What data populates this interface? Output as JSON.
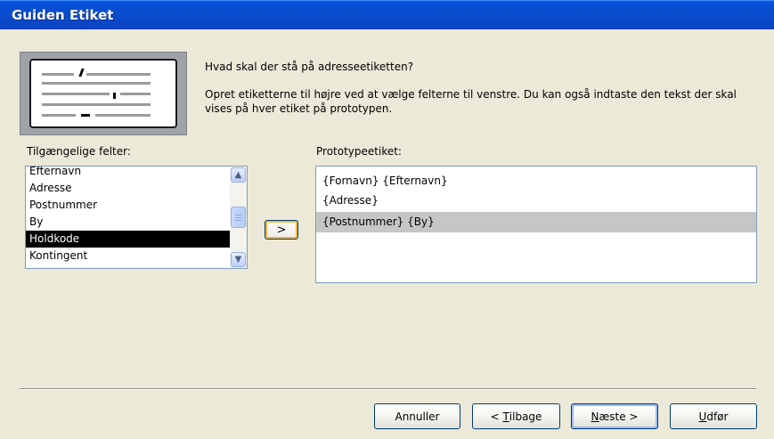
{
  "window": {
    "title": "Guiden Etiket"
  },
  "header": {
    "prompt": "Hvad skal der stå på adresseetiketten?",
    "description": "Opret etiketterne til højre ved at vælge felterne til venstre. Du kan også indtaste den tekst der skal vises på hver etiket på prototypen."
  },
  "available_fields": {
    "label": "Tilgængelige felter:",
    "items": [
      "Efternavn",
      "Adresse",
      "Postnummer",
      "By",
      "Holdkode",
      "Kontingent"
    ],
    "selected": "Holdkode"
  },
  "add_button": {
    "label": ">"
  },
  "prototype": {
    "label": "Prototypeetiket:",
    "lines": [
      "{Fornavn} {Efternavn}",
      "{Adresse}",
      "{Postnummer}  {By}"
    ]
  },
  "buttons": {
    "cancel": "Annuller",
    "back_prefix": "< ",
    "back_key": "T",
    "back_rest": "ilbage",
    "next_key": "N",
    "next_rest": "æste >",
    "finish_key": "U",
    "finish_rest": "dfør"
  }
}
